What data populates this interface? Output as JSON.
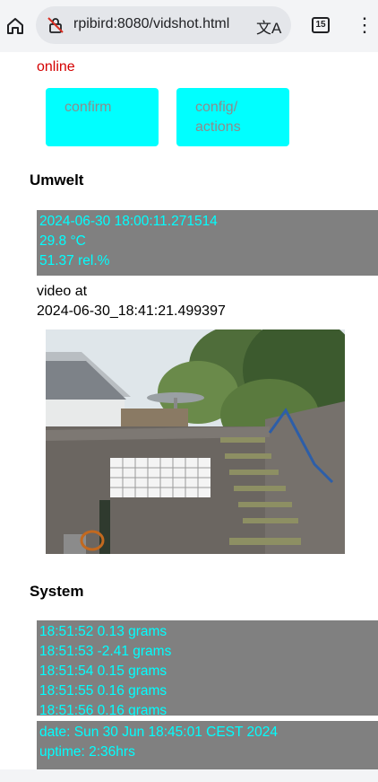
{
  "browser": {
    "url": "rpibird:8080/vidshot.html",
    "tab_count": "15",
    "menu_glyph": "⋮",
    "translate_glyph": "文A"
  },
  "status": "online",
  "buttons": {
    "confirm": "confirm",
    "config_line1": "config/",
    "config_line2": "actions"
  },
  "umwelt": {
    "heading": "Umwelt",
    "timestamp": "2024-06-30 18:00:11.271514",
    "temperature": "29.8 °C",
    "humidity": "51.37 rel.%"
  },
  "video": {
    "line1": "video at",
    "line2": "2024-06-30_18:41:21.499397"
  },
  "system": {
    "heading": "System",
    "weights": [
      "18:51:52 0.13 grams",
      "18:51:53 -2.41 grams",
      "18:51:54 0.15 grams",
      "18:51:55 0.16 grams",
      "18:51:56 0.16 grams"
    ],
    "date": "date: Sun 30 Jun 18:45:01 CEST 2024",
    "uptime": "uptime: 2:36hrs"
  }
}
